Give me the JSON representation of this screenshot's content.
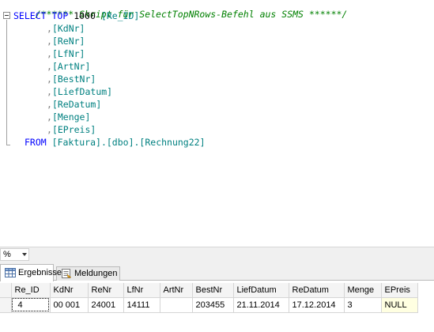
{
  "editor": {
    "comment": "/****** Skript für SelectTopNRows-Befehl aus SSMS ******/",
    "select_kw": "SELECT",
    "top_kw": "TOP",
    "top_value": "1000",
    "first_column": "[Re_ID]",
    "columns": [
      "[KdNr]",
      "[ReNr]",
      "[LfNr]",
      "[ArtNr]",
      "[BestNr]",
      "[LiefDatum]",
      "[ReDatum]",
      "[Menge]",
      "[EPreis]"
    ],
    "from_kw": "FROM",
    "table_ref": "[Faktura].[dbo].[Rechnung22]"
  },
  "zoom": {
    "value": "%"
  },
  "tabs": {
    "results_label": "Ergebnisse",
    "messages_label": "Meldungen"
  },
  "grid": {
    "columns": [
      "Re_ID",
      "KdNr",
      "ReNr",
      "LfNr",
      "ArtNr",
      "BestNr",
      "LiefDatum",
      "ReDatum",
      "Menge",
      "EPreis"
    ],
    "rows": [
      {
        "row_number": "",
        "cells": [
          "4",
          "00 001",
          "24001",
          "14111",
          "",
          "203455",
          "21.11.2014",
          "17.12.2014",
          "3",
          "NULL"
        ]
      }
    ]
  },
  "colors": {
    "keyword": "#0000ff",
    "identifier": "#008080",
    "comment": "#008000",
    "null_cell_bg": "#ffffe1"
  }
}
